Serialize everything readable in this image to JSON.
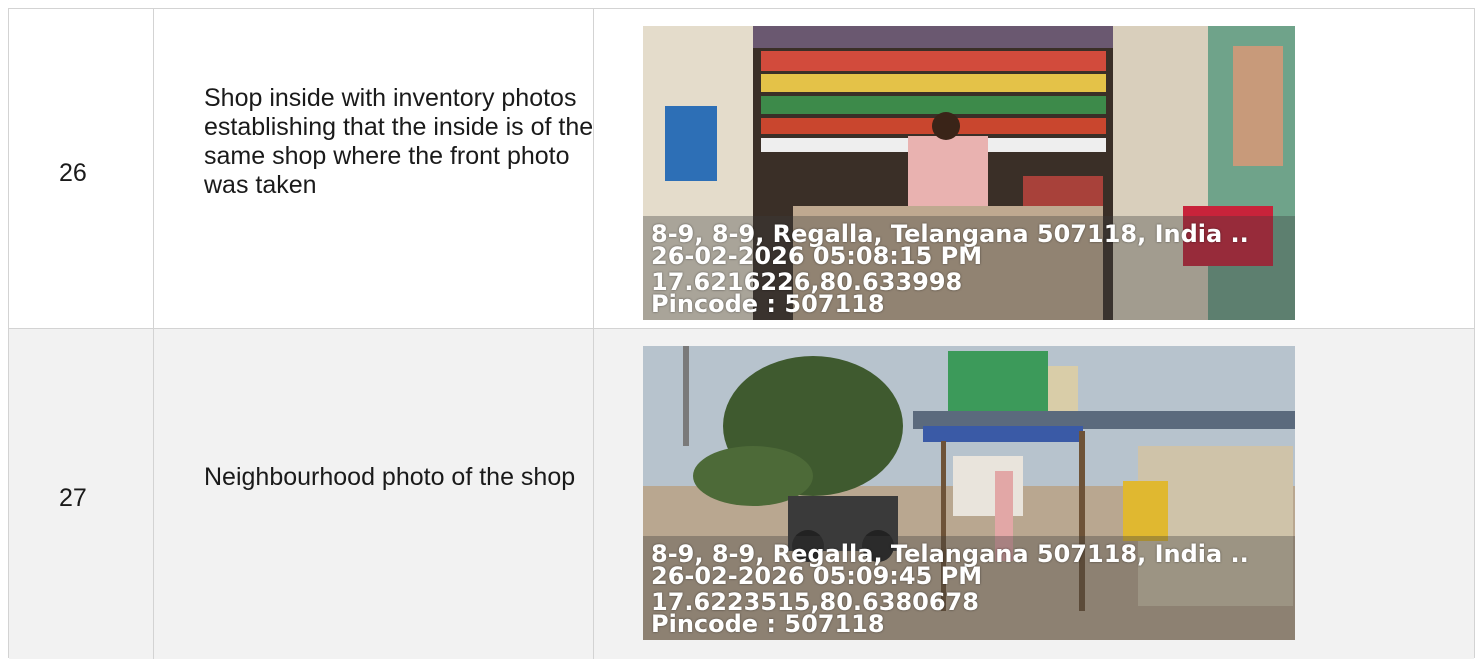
{
  "rows": [
    {
      "number": "26",
      "description": "Shop inside with inventory photos establishing that the inside is of the same shop where the front photo was taken",
      "photo": {
        "address": "8-9, 8-9, Regalla, Telangana 507118, India ..",
        "datetime": "26-02-2026 05:08:15 PM",
        "coords": "17.6216226,80.633998",
        "pincode": "Pincode : 507118"
      }
    },
    {
      "number": "27",
      "description": "Neighbourhood photo of the shop",
      "photo": {
        "address": "8-9, 8-9, Regalla, Telangana 507118, India ..",
        "datetime": "26-02-2026 05:09:45 PM",
        "coords": "17.6223515,80.6380678",
        "pincode": "Pincode : 507118"
      }
    }
  ]
}
